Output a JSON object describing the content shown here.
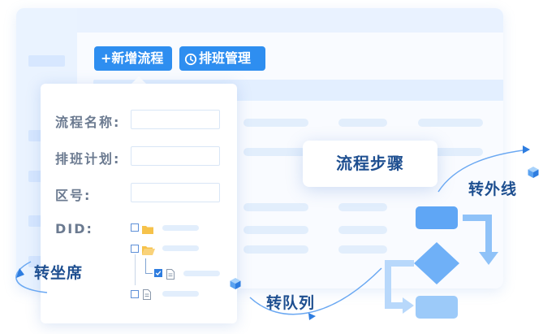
{
  "toolbar": {
    "add_flow_label": "+新增流程",
    "schedule_label": "排班管理",
    "schedule_icon": "clock-icon"
  },
  "form": {
    "flow_name_label": "流程名称:",
    "schedule_plan_label": "排班计划:",
    "zone_label": "区号:",
    "did_label": "DID:"
  },
  "tree_icons": [
    "folder-icon",
    "folder-open-icon",
    "document-icon",
    "document-icon"
  ],
  "floating_labels": {
    "flow_steps": "流程步骤",
    "to_agent": "转坐席",
    "to_queue": "转队列",
    "to_external": "转外线"
  },
  "colors": {
    "primary_blue": "#2e8ef0",
    "dark_text": "#1e4f90",
    "light_blue": "#e2eefc",
    "flow_shape": "#7fb6f7"
  }
}
